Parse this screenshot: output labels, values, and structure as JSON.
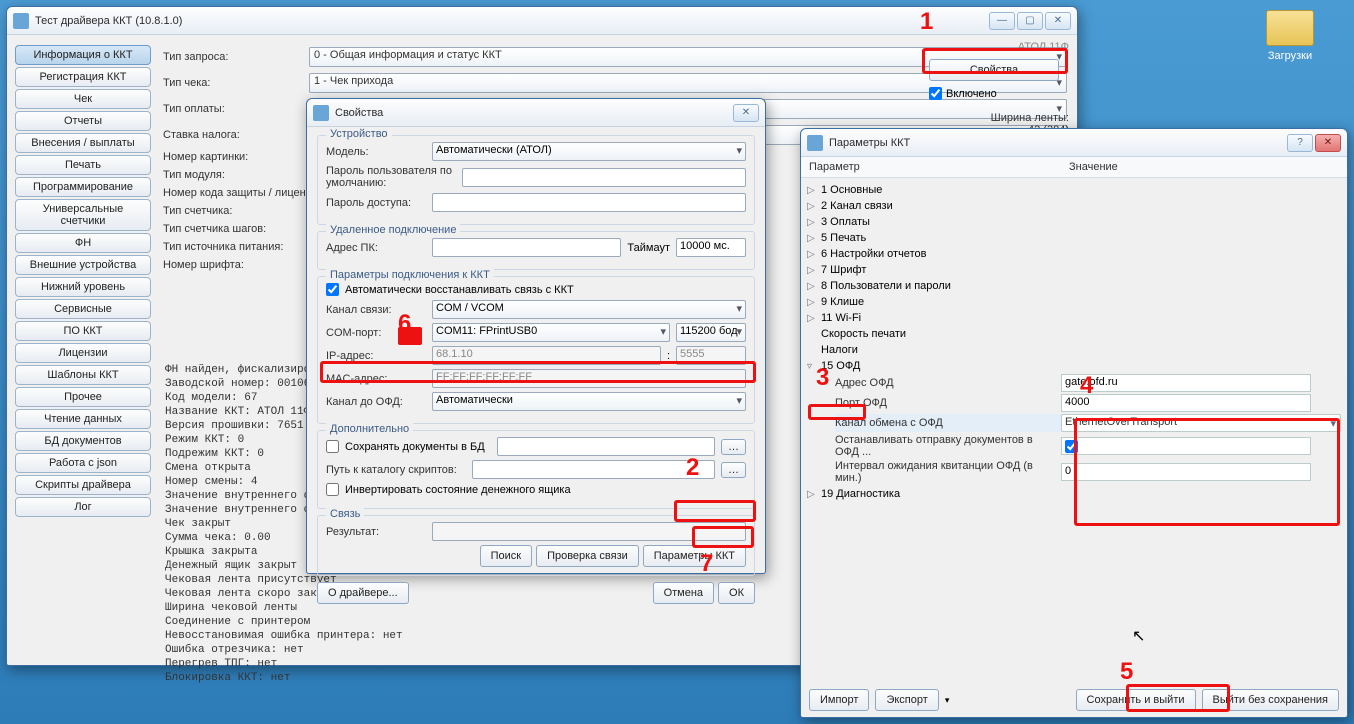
{
  "desktop": {
    "downloads": "Загрузки"
  },
  "mainWin": {
    "title": "Тест драйвера ККТ (10.8.1.0)",
    "sidebar": [
      "Информация о ККТ",
      "Регистрация ККТ",
      "Чек",
      "Отчеты",
      "Внесения / выплаты",
      "Печать",
      "Программирование",
      "Универсальные счетчики",
      "ФН",
      "Внешние устройства",
      "Нижний уровень",
      "Сервисные",
      "ПО ККТ",
      "Лицензии",
      "Шаблоны ККТ",
      "Прочее",
      "Чтение данных",
      "БД документов",
      "Работа с json",
      "Скрипты драйвера",
      "Лог"
    ],
    "labels": {
      "reqType": "Тип запроса:",
      "chkType": "Тип чека:",
      "payType": "Тип оплаты:",
      "taxRate": "Ставка налога:",
      "picNum": "Номер картинки:",
      "modType": "Тип модуля:",
      "licCode": "Номер кода защиты / лицензии:",
      "cntType": "Тип счетчика:",
      "stepCntType": "Тип счетчика шагов:",
      "powerSrc": "Тип источника питания:",
      "fontNum": "Номер шрифта:"
    },
    "values": {
      "reqType": "0 - Общая информация и статус ККТ",
      "chkType": "1 - Чек прихода"
    },
    "props": {
      "btn": "Свойства",
      "enabled": "Включено",
      "tapeWidth": "Ширина ленты:",
      "tapeWidthVal": "42 (384)",
      "modelHint": "АТОЛ 11Ф"
    },
    "log": "ФН найден, фискализирован\nЗаводской номер: 00106\nКод модели: 67\nНазвание ККТ: АТОЛ 11Ф\nВерсия прошивки: 7651\nРежим ККТ: 0\nПодрежим ККТ: 0\nСмена открыта\nНомер смены: 4\nЗначение внутреннего счетчика\nЗначение внутреннего счетчика шагов\nЧек закрыт\nСумма чека: 0.00\nКрышка закрыта\nДенежный ящик закрыт\nЧековая лента присутствует\nЧековая лента скоро закончится\nШирина чековой ленты\nСоединение с принтером\nНевосстановимая ошибка принтера: нет\nОшибка отрезчика: нет\nПерегрев ТПГ: нет\nБлокировка ККТ: нет"
  },
  "propsDlg": {
    "title": "Свойства",
    "grp_device": "Устройство",
    "model": "Модель:",
    "modelVal": "Автоматически (АТОЛ)",
    "defPass": "Пароль пользователя по умолчанию:",
    "accPass": "Пароль доступа:",
    "grp_remote": "Удаленное подключение",
    "pcAddr": "Адрес ПК:",
    "timeout": "Таймаут",
    "timeoutVal": "10000 мс.",
    "grp_conn": "Параметры подключения к ККТ",
    "autoRestore": "Автоматически восстанавливать связь с ККТ",
    "chan": "Канал связи:",
    "chanVal": "COM / VCOM",
    "comPort": "COM-порт:",
    "comVal": "COM11: FPrintUSB0",
    "baud": "115200 бод",
    "ip": "IP-адрес:",
    "ipVal": "68.1.10",
    "ipPort": "5555",
    "mac": "MAC-адрес:",
    "macVal": "FF:FF:FF:FF:FF:FF",
    "chanOfd": "Канал до ОФД:",
    "chanOfdVal": "Автоматически",
    "grp_extra": "Дополнительно",
    "saveDocs": "Сохранять документы в БД",
    "scriptPath": "Путь к каталогу скриптов:",
    "invertDrawer": "Инвертировать состояние денежного ящика",
    "grp_link": "Связь",
    "result": "Результат:",
    "btns": {
      "about": "О драйвере...",
      "find": "Поиск",
      "check": "Проверка связи",
      "params": "Параметры ККТ",
      "cancel": "Отмена",
      "ok": "ОК"
    }
  },
  "paramsDlg": {
    "title": "Параметры ККТ",
    "colParam": "Параметр",
    "colVal": "Значение",
    "nodes": [
      "1 Основные",
      "2 Канал связи",
      "3 Оплаты",
      "5 Печать",
      "6 Настройки отчетов",
      "7 Шрифт",
      "8 Пользователи и пароли",
      "9 Клише",
      "11 Wi-Fi",
      "Скорость печати",
      "Налоги"
    ],
    "ofdNode": "15 ОФД",
    "ofd": {
      "addr": "Адрес ОФД",
      "addrVal": "gate.ofd.ru",
      "port": "Порт ОФД",
      "portVal": "4000",
      "chan": "Канал обмена с ОФД",
      "chanVal": "EthernetOverTransport",
      "stopSend": "Останавливать отправку документов в ОФД ...",
      "waitInt": "Интервал ожидания квитанции ОФД (в мин.)",
      "waitVal": "0"
    },
    "diag": "19 Диагностика",
    "foot": {
      "import": "Импорт",
      "export": "Экспорт",
      "save": "Сохранить и выйти",
      "exit": "Выйти без сохранения"
    }
  },
  "markers": {
    "n1": "1",
    "n2": "2",
    "n3": "3",
    "n4": "4",
    "n5": "5",
    "n6": "6",
    "n7": "7"
  }
}
